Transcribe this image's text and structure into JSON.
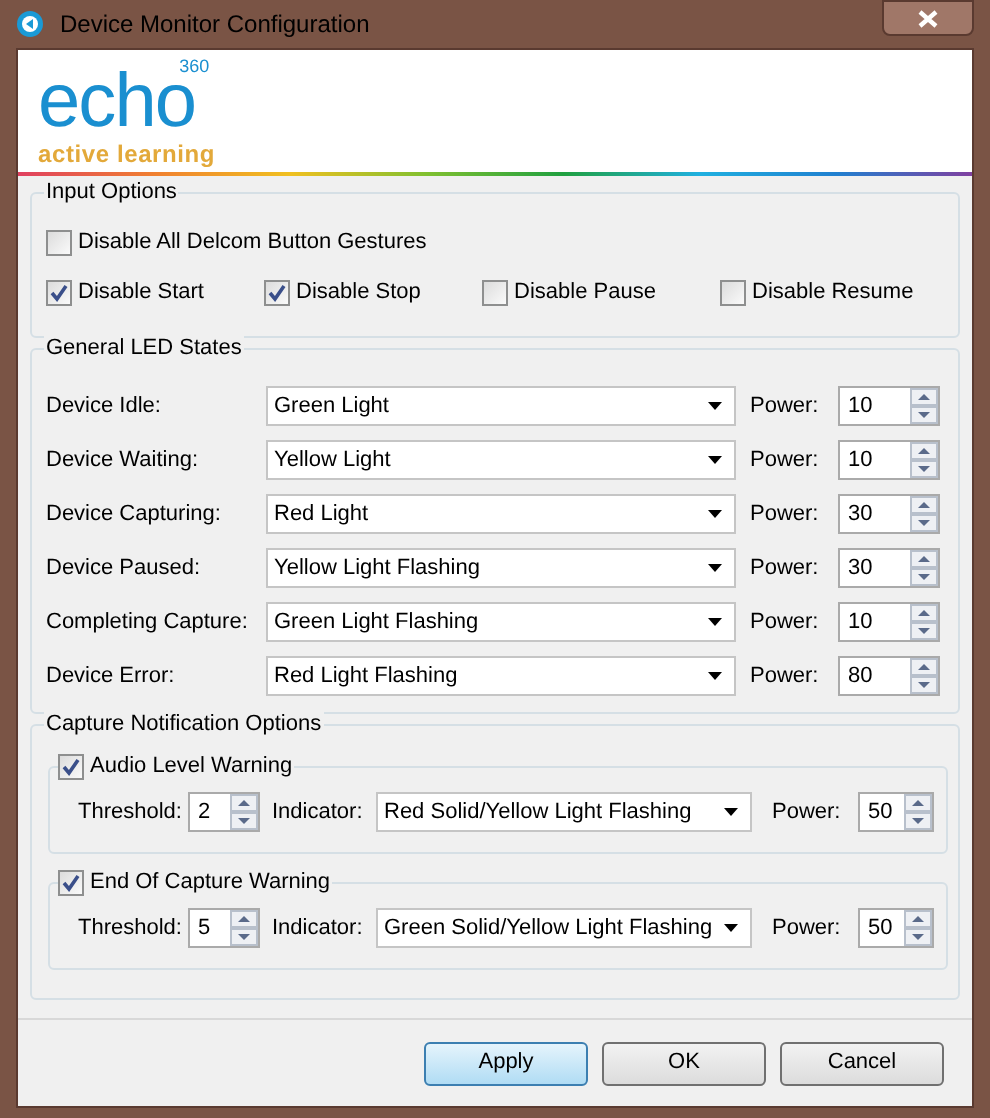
{
  "window": {
    "title": "Device Monitor Configuration"
  },
  "logo": {
    "name": "echo",
    "superscript": "360",
    "tagline": "active learning"
  },
  "input_options": {
    "title": "Input Options",
    "checkboxes": [
      {
        "label": "Disable All Delcom Button Gestures",
        "checked": false
      },
      {
        "label": "Disable Start",
        "checked": true
      },
      {
        "label": "Disable Stop",
        "checked": true
      },
      {
        "label": "Disable Pause",
        "checked": false
      },
      {
        "label": "Disable Resume",
        "checked": false
      }
    ]
  },
  "led_states": {
    "title": "General LED States",
    "rows": [
      {
        "label": "Device Idle:",
        "value": "Green Light",
        "power_label": "Power:",
        "power": "10"
      },
      {
        "label": "Device Waiting:",
        "value": "Yellow Light",
        "power_label": "Power:",
        "power": "10"
      },
      {
        "label": "Device Capturing:",
        "value": "Red Light",
        "power_label": "Power:",
        "power": "30"
      },
      {
        "label": "Device Paused:",
        "value": "Yellow Light Flashing",
        "power_label": "Power:",
        "power": "30"
      },
      {
        "label": "Completing Capture:",
        "value": "Green Light Flashing",
        "power_label": "Power:",
        "power": "10"
      },
      {
        "label": "Device Error:",
        "value": "Red Light Flashing",
        "power_label": "Power:",
        "power": "80"
      }
    ]
  },
  "capture_notifications": {
    "title": "Capture Notification Options",
    "groups": [
      {
        "label": "Audio Level Warning",
        "checked": true,
        "threshold_label": "Threshold:",
        "threshold": "2",
        "indicator_label": "Indicator:",
        "indicator": "Red Solid/Yellow Light Flashing",
        "power_label": "Power:",
        "power": "50"
      },
      {
        "label": "End Of Capture Warning",
        "checked": true,
        "threshold_label": "Threshold:",
        "threshold": "5",
        "indicator_label": "Indicator:",
        "indicator": "Green Solid/Yellow Light Flashing",
        "power_label": "Power:",
        "power": "50"
      }
    ]
  },
  "buttons": [
    {
      "label": "Apply",
      "default": true
    },
    {
      "label": "OK",
      "default": false
    },
    {
      "label": "Cancel",
      "default": false
    }
  ]
}
